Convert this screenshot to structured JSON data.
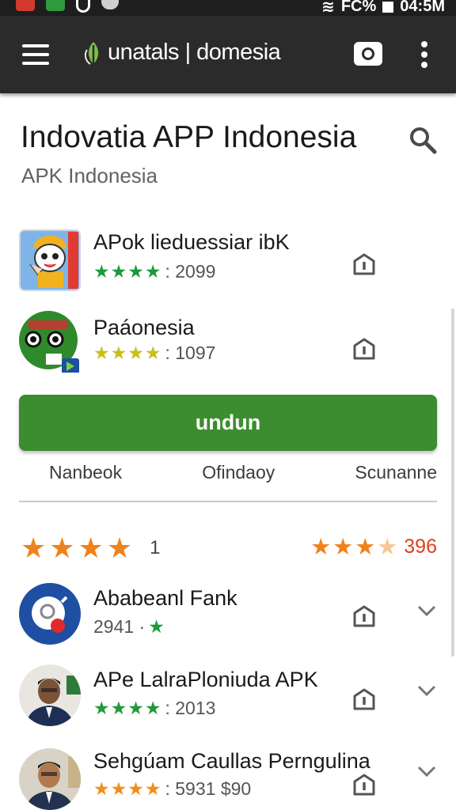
{
  "status_bar": {
    "network": "FC%",
    "time": "04:5M"
  },
  "app_bar": {
    "brand": "unatals | domesia"
  },
  "header": {
    "title": "Indovatia APP Indonesia",
    "subtitle": "APK Indonesia"
  },
  "featured_apps": [
    {
      "name": "APok lieduessiar ibK",
      "rating_value": ": 2099",
      "star_color": "green"
    },
    {
      "name": "Paáonesia",
      "rating_value": ": 1097",
      "star_color": "yellow"
    }
  ],
  "install_button": {
    "label": "undun"
  },
  "tabs": [
    "Nanbeok",
    "Ofindaoy",
    "Scunanne"
  ],
  "ratings": {
    "left_count": "1",
    "right_count": "396"
  },
  "more_apps": [
    {
      "name": "Ababeanl Fank",
      "rating_value": "2941 ·",
      "stars": "★"
    },
    {
      "name": "APe LalraPloniuda APK",
      "rating_value": ": 2013",
      "stars": "★★★★"
    },
    {
      "name": "Sehgúam Caullas Perngulina",
      "rating_value": ": 5931  $90",
      "stars": "★★★★"
    }
  ],
  "colors": {
    "app_bar": "#2b2b2b",
    "install_green": "#3b8d2f",
    "star_green": "#1f9a3a",
    "star_orange": "#f0821a",
    "accent_red": "#e0401a"
  }
}
